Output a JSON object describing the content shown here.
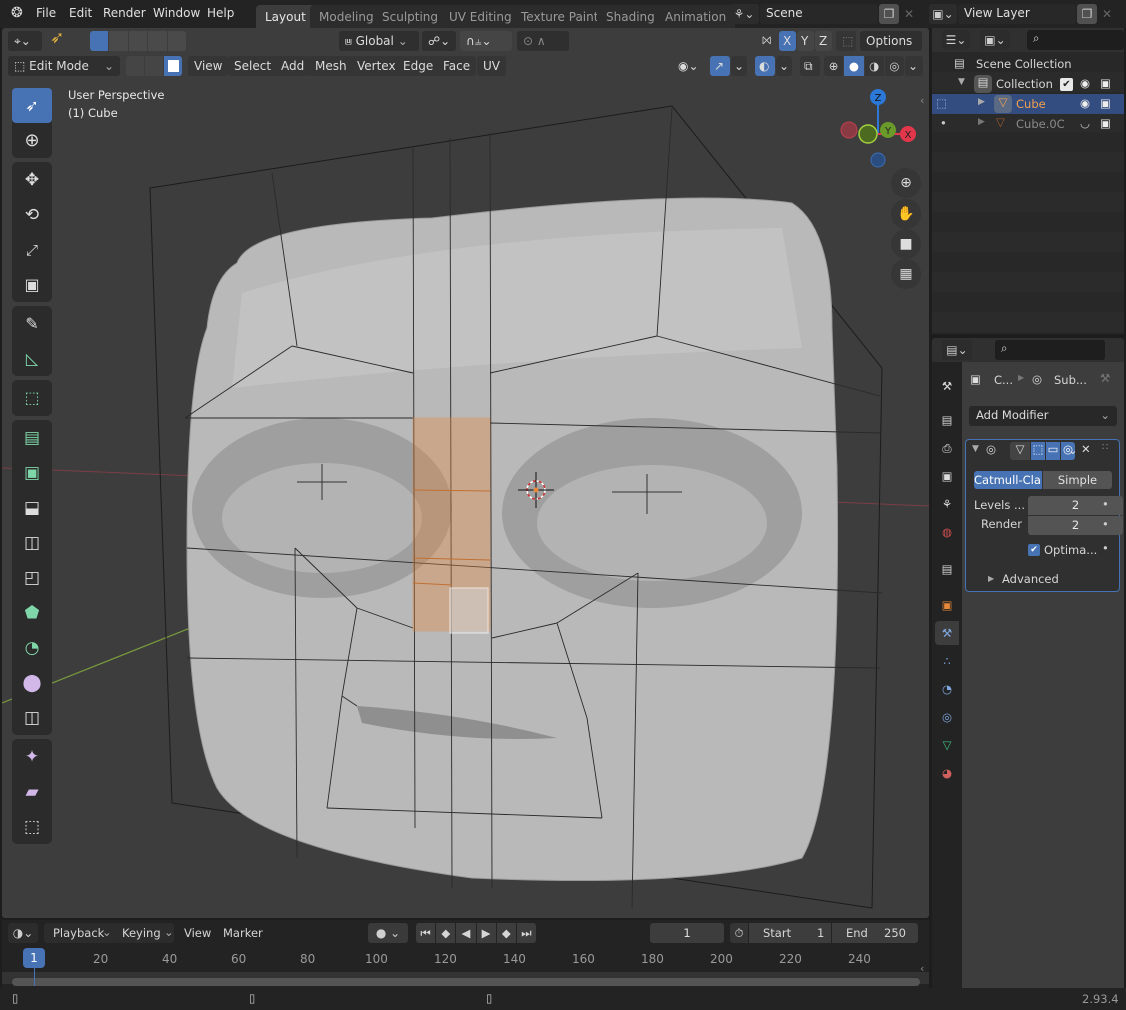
{
  "topbar": {
    "menus": [
      "File",
      "Edit",
      "Render",
      "Window",
      "Help"
    ],
    "workspaces": [
      "Layout",
      "Modeling",
      "Sculpting",
      "UV Editing",
      "Texture Paint",
      "Shading",
      "Animation"
    ],
    "active_workspace": "Layout",
    "scene": "Scene",
    "view_layer": "View Layer"
  },
  "tool_header": {
    "transform_orientation": "Global",
    "axes": [
      "X",
      "Y",
      "Z"
    ],
    "options_label": "Options"
  },
  "viewport_header": {
    "mode": "Edit Mode",
    "menus": [
      "View",
      "Select",
      "Add",
      "Mesh",
      "Vertex",
      "Edge",
      "Face",
      "UV"
    ]
  },
  "viewport": {
    "view_name": "User Perspective",
    "object_info": "(1) Cube",
    "gizmo_axes": {
      "z": "Z",
      "y": "Y",
      "x": "X"
    },
    "colors": {
      "x": "#e2374b",
      "y": "#86b527",
      "z": "#2b78d8",
      "selection": "#e8883a"
    }
  },
  "tools": [
    {
      "name": "select-box-icon",
      "active": true
    },
    {
      "name": "cursor-icon"
    },
    {
      "name": "move-icon"
    },
    {
      "name": "rotate-icon"
    },
    {
      "name": "scale-icon"
    },
    {
      "name": "transform-icon"
    },
    {
      "name": "annotate-icon"
    },
    {
      "name": "measure-icon"
    },
    {
      "name": "add-cube-icon"
    },
    {
      "name": "extrude-region-icon"
    },
    {
      "name": "inset-faces-icon"
    },
    {
      "name": "bevel-icon"
    },
    {
      "name": "loop-cut-icon"
    },
    {
      "name": "knife-icon"
    },
    {
      "name": "poly-build-icon"
    },
    {
      "name": "spin-icon"
    },
    {
      "name": "smooth-icon"
    },
    {
      "name": "edge-slide-icon"
    },
    {
      "name": "shrink-fatten-icon"
    },
    {
      "name": "shear-icon"
    },
    {
      "name": "rip-region-icon"
    }
  ],
  "outliner": {
    "root": "Scene Collection",
    "collection": "Collection",
    "items": [
      {
        "name": "Cube",
        "selected": true
      },
      {
        "name": "Cube.0C",
        "selected": false
      }
    ]
  },
  "properties": {
    "breadcrumb_object": "C...",
    "breadcrumb_modifier": "Sub...",
    "add_modifier": "Add Modifier",
    "subdiv_types": [
      "Catmull-Cla...",
      "Simple"
    ],
    "active_type": "Catmull-Cla...",
    "levels_label": "Levels ...",
    "levels_value": "2",
    "render_label": "Render",
    "render_value": "2",
    "optimal_label": "Optima...",
    "optimal_checked": true,
    "advanced_label": "Advanced"
  },
  "timeline": {
    "menus": [
      "Playback",
      "Keying",
      "View",
      "Marker"
    ],
    "current_frame": "1",
    "start_label": "Start",
    "start_value": "1",
    "end_label": "End",
    "end_value": "250",
    "ticks": [
      "1",
      "20",
      "40",
      "60",
      "80",
      "100",
      "120",
      "140",
      "160",
      "180",
      "200",
      "220",
      "240"
    ]
  },
  "status": {
    "version": "2.93.4"
  }
}
